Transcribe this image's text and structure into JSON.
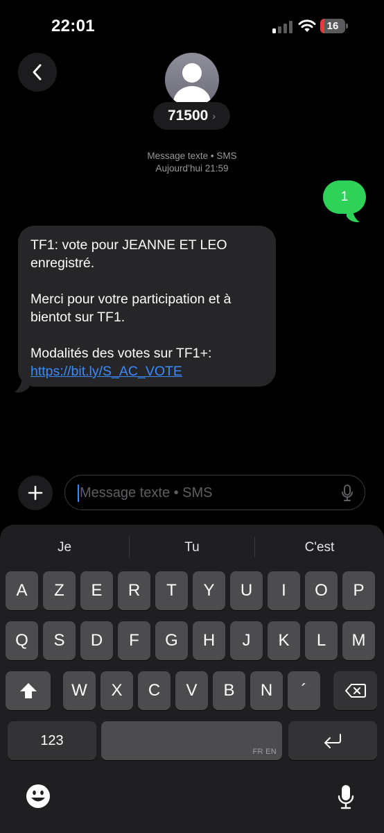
{
  "status_bar": {
    "time": "22:01",
    "battery_level": "16",
    "battery_fraction": 0.16,
    "signal_bars_filled": 1,
    "signal_bars_total": 4
  },
  "header": {
    "back_icon": "chevron-left-icon",
    "avatar_icon": "person-silhouette-icon",
    "contact_name": "71500",
    "contact_chevron": "›"
  },
  "conversation": {
    "meta_line1": "Message texte • SMS",
    "meta_line2": "Aujourd’hui 21:59",
    "messages": [
      {
        "direction": "sent",
        "text": "1",
        "color": "#30d158"
      },
      {
        "direction": "received",
        "color": "#262628",
        "paragraphs": [
          "TF1: vote pour JEANNE ET LEO enregistré.",
          "Merci pour votre participation et à bientot sur TF1.",
          "Modalités des votes sur TF1+:"
        ],
        "link": "https://bit.ly/S_AC_VOTE"
      }
    ]
  },
  "composer": {
    "placeholder": "Message texte • SMS",
    "plus_icon": "plus-icon",
    "mic_icon": "microphone-icon"
  },
  "keyboard": {
    "suggestions": [
      "Je",
      "Tu",
      "C'est"
    ],
    "row1": [
      "A",
      "Z",
      "E",
      "R",
      "T",
      "Y",
      "U",
      "I",
      "O",
      "P"
    ],
    "row2": [
      "Q",
      "S",
      "D",
      "F",
      "G",
      "H",
      "J",
      "K",
      "L",
      "M"
    ],
    "row3": [
      "W",
      "X",
      "C",
      "V",
      "B",
      "N",
      "´"
    ],
    "shift_icon": "shift-icon",
    "delete_icon": "backspace-icon",
    "numbers_label": "123",
    "space_lang": "FR EN",
    "return_icon": "return-icon",
    "emoji_icon": "emoji-icon",
    "dictation_icon": "microphone-icon"
  },
  "colors": {
    "accent": "#3b8bff",
    "sent_bubble": "#30d158",
    "received_bubble": "#262628"
  }
}
